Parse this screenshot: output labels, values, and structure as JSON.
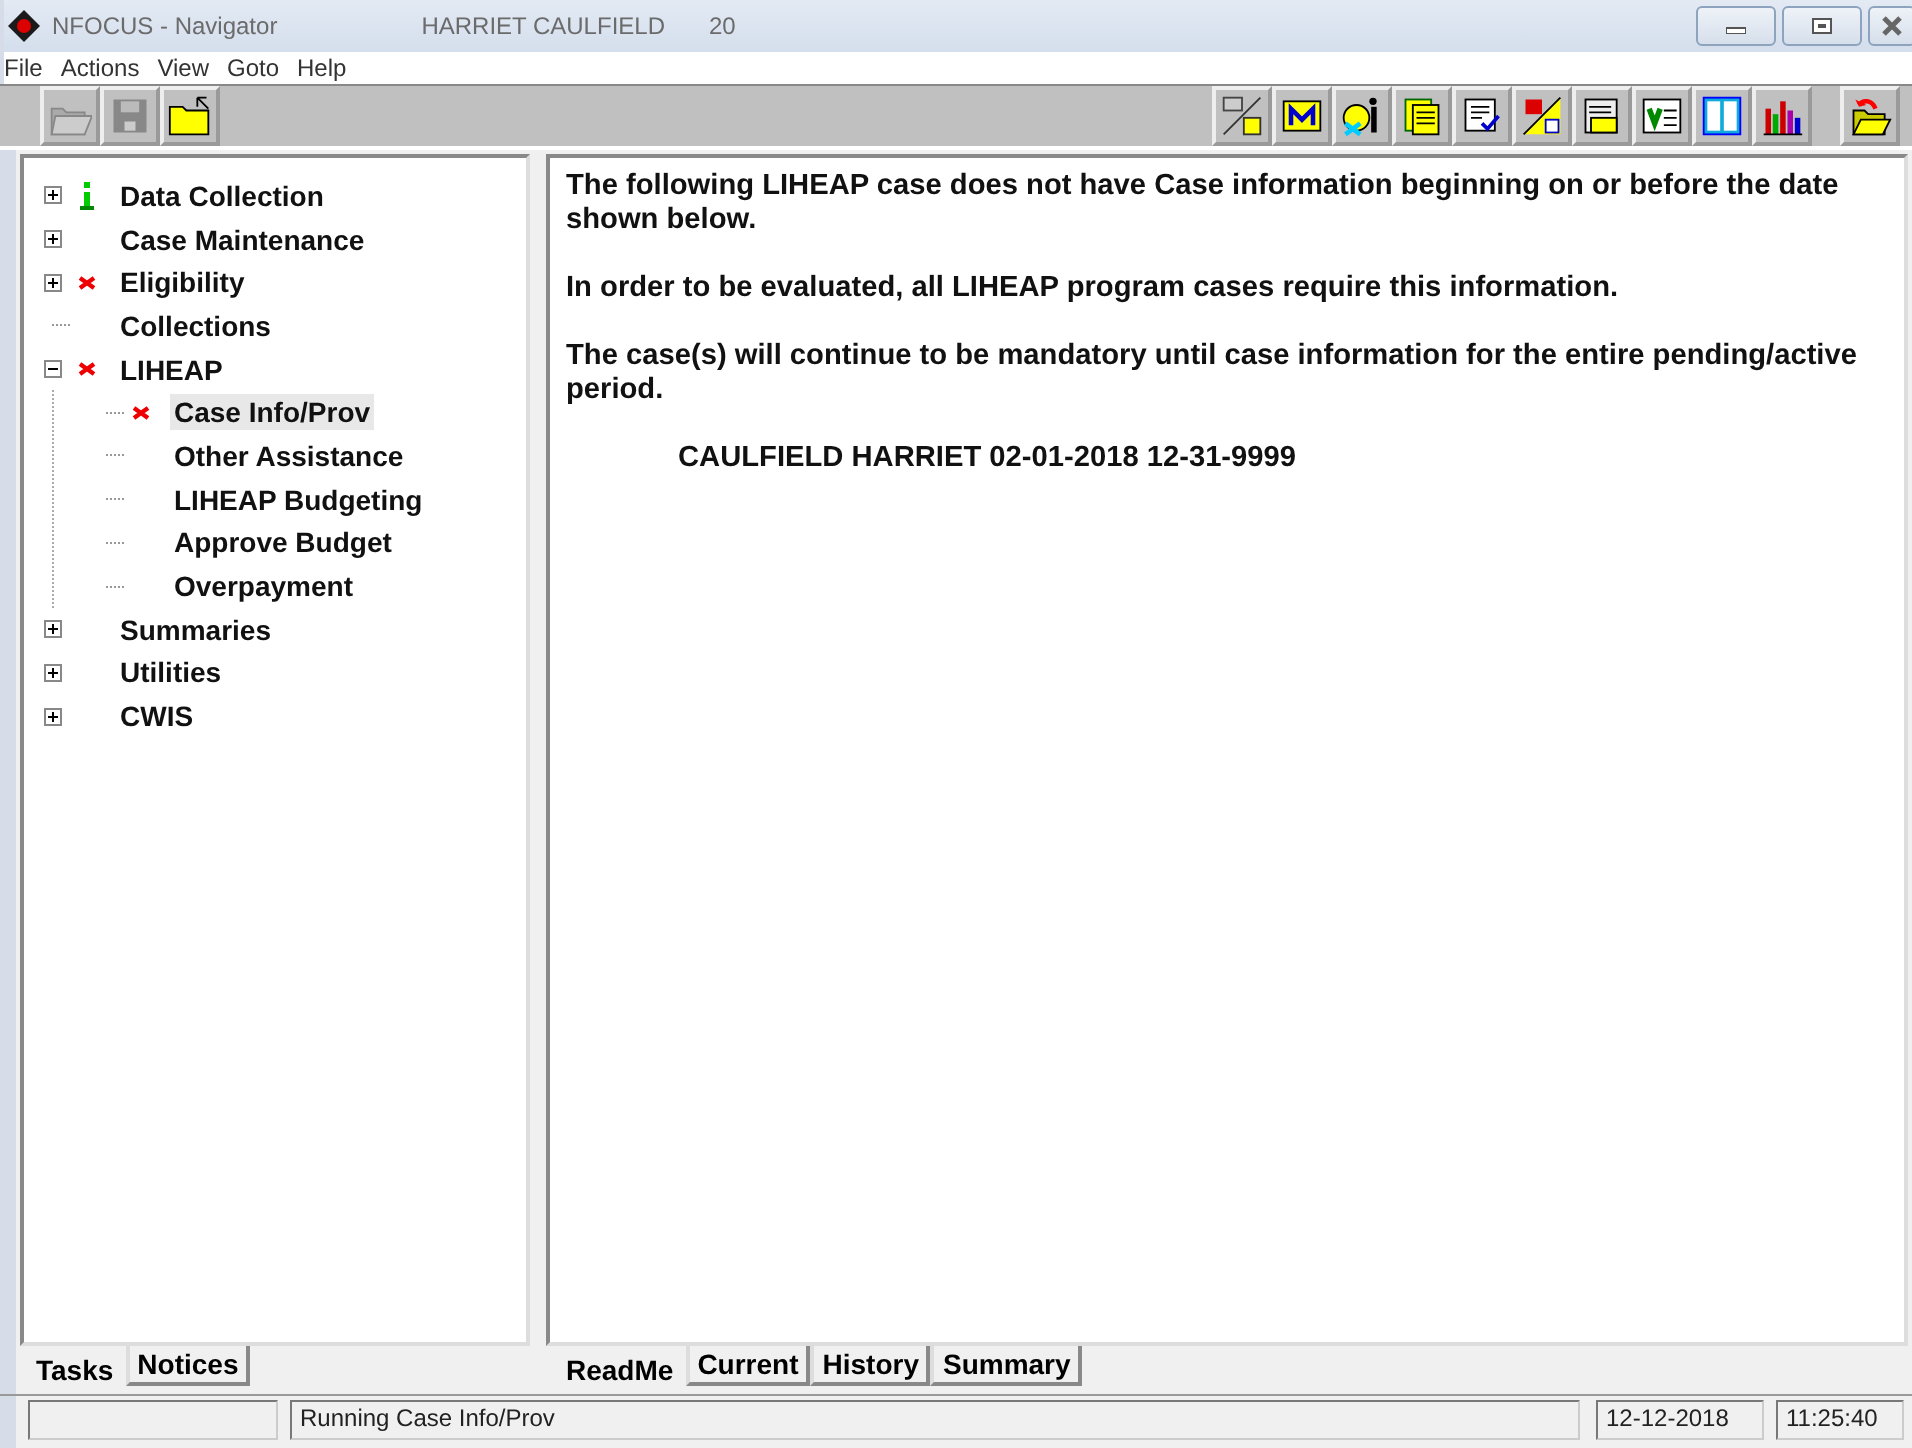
{
  "window": {
    "title": "NFOCUS - Navigator",
    "subtitle": "HARRIET CAULFIELD",
    "number": "20"
  },
  "menu": [
    "File",
    "Actions",
    "View",
    "Goto",
    "Help"
  ],
  "tree": [
    {
      "label": "Data Collection",
      "kind": "group",
      "expanded": false,
      "info": true,
      "alert": false,
      "selected": false
    },
    {
      "label": "Case Maintenance",
      "kind": "group",
      "expanded": false,
      "info": false,
      "alert": false,
      "selected": false
    },
    {
      "label": "Eligibility",
      "kind": "group",
      "expanded": false,
      "info": false,
      "alert": true,
      "selected": false
    },
    {
      "label": "Collections",
      "kind": "leaf",
      "info": false,
      "alert": false,
      "selected": false
    },
    {
      "label": "LIHEAP",
      "kind": "group",
      "expanded": true,
      "info": false,
      "alert": true,
      "selected": false,
      "children": [
        {
          "label": "Case Info/Prov",
          "kind": "leaf",
          "info": false,
          "alert": true,
          "selected": true
        },
        {
          "label": "Other Assistance",
          "kind": "leaf",
          "info": false,
          "alert": false,
          "selected": false
        },
        {
          "label": "LIHEAP Budgeting",
          "kind": "leaf",
          "info": false,
          "alert": false,
          "selected": false
        },
        {
          "label": "Approve Budget",
          "kind": "leaf",
          "info": false,
          "alert": false,
          "selected": false
        },
        {
          "label": "Overpayment",
          "kind": "leaf",
          "info": false,
          "alert": false,
          "selected": false
        }
      ]
    },
    {
      "label": "Summaries",
      "kind": "group",
      "expanded": false,
      "info": false,
      "alert": false,
      "selected": false
    },
    {
      "label": "Utilities",
      "kind": "group",
      "expanded": false,
      "info": false,
      "alert": false,
      "selected": false
    },
    {
      "label": "CWIS",
      "kind": "group",
      "expanded": false,
      "info": false,
      "alert": false,
      "selected": false
    }
  ],
  "left_tabs": [
    {
      "label": "Tasks",
      "selected": true
    },
    {
      "label": "Notices",
      "selected": false
    }
  ],
  "content": {
    "paragraphs": [
      "The following LIHEAP case does not have Case information beginning on or before the date shown below.",
      "In order to be evaluated, all LIHEAP program cases require this information.",
      "The case(s) will continue to be mandatory until case information for the entire pending/active period."
    ],
    "case_line": "CAULFIELD HARRIET 02-01-2018 12-31-9999"
  },
  "right_tabs": [
    {
      "label": "ReadMe",
      "selected": true
    },
    {
      "label": "Current",
      "selected": false
    },
    {
      "label": "History",
      "selected": false
    },
    {
      "label": "Summary",
      "selected": false
    }
  ],
  "status_bar": {
    "message": "Running Case Info/Prov",
    "date": "12-12-2018",
    "time": "11:25:40"
  }
}
